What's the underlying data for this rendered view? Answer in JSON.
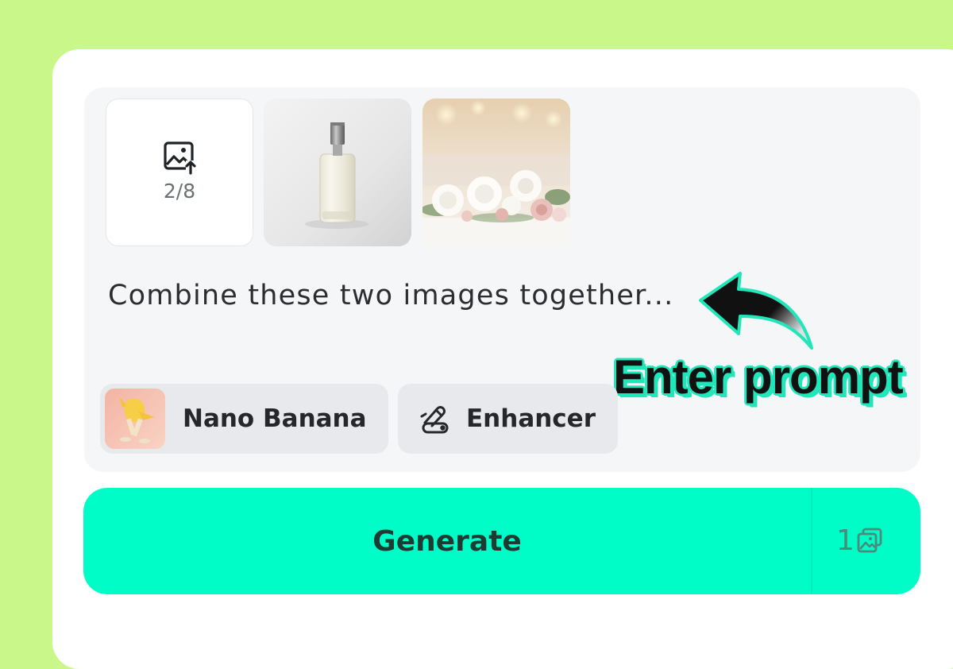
{
  "uploader": {
    "count": "2/8",
    "icon": "image-upload-icon"
  },
  "images": [
    {
      "alt": "perfume bottle"
    },
    {
      "alt": "white and pink flowers"
    }
  ],
  "prompt": {
    "text": "Combine these two images together..."
  },
  "annotation": {
    "text": "Enter prompt",
    "outline_color": "#21e6b9"
  },
  "model_chip": {
    "label": "Nano Banana",
    "avatar": "nano-banana-avatar"
  },
  "enhancer_chip": {
    "label": "Enhancer",
    "icon": "magic-wand-toggle-icon"
  },
  "generate_button": {
    "label": "Generate",
    "credit_count": "1",
    "credit_icon": "images-icon",
    "color": "#00fdc8"
  },
  "colors": {
    "background": "#c9f78a",
    "card": "#ffffff",
    "panel": "#f5f6f8",
    "chip": "#e8e9ec"
  }
}
